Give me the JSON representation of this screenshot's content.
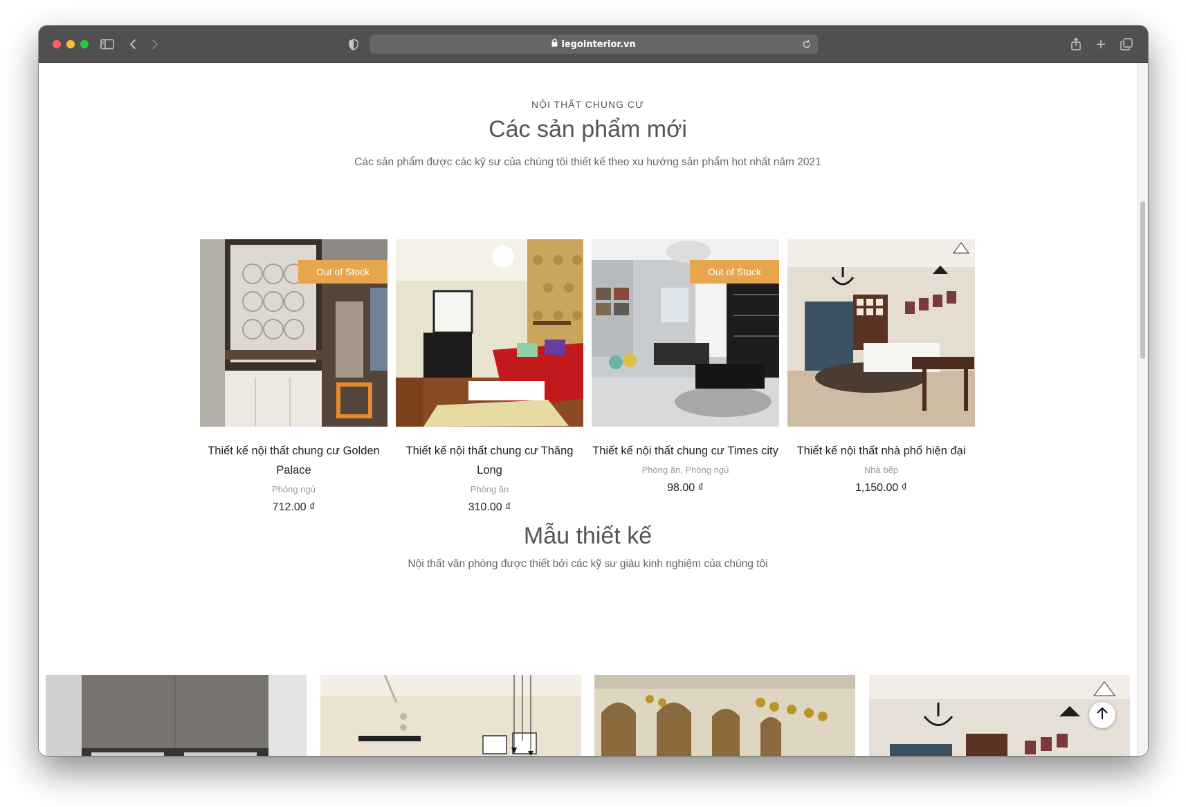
{
  "browser": {
    "url": "legointerior.vn",
    "lock_icon": "lock-icon",
    "icons": [
      "sidebar-icon",
      "back-icon",
      "forward-icon",
      "shield-icon",
      "reload-icon",
      "share-icon",
      "new-tab-icon",
      "tabs-icon"
    ]
  },
  "new_products": {
    "eyebrow": "NỘI THẤT CHUNG CƯ",
    "heading": "Các sản phẩm mới",
    "subheading": "Các sản phẩm được các kỹ sư của chúng tôi thiết kế theo xu hướng sản phẩm hot nhất năm 2021",
    "badge_label": "Out of Stock",
    "badge_color": "#e8a64c",
    "products": [
      {
        "title": "Thiết kế nội thất chung cư Golden Palace",
        "category": "Phòng ngủ",
        "price": "712.00 ₫",
        "out_of_stock": true
      },
      {
        "title": "Thiết kế nội thất chung cư Thăng Long",
        "category": "Phòng ăn",
        "price": "310.00 ₫",
        "out_of_stock": false
      },
      {
        "title": "Thiết kế nội thất chung cư Times city",
        "category": "Phòng ăn, Phòng ngủ",
        "price": "98.00 ₫",
        "out_of_stock": true
      },
      {
        "title": "Thiết kế nội thất nhà phố hiện đại",
        "category": "Nhà bếp",
        "price": "1,150.00 ₫",
        "out_of_stock": false
      }
    ]
  },
  "designs": {
    "heading": "Mẫu thiết kế",
    "subheading": "Nội thất văn phòng được thiết bởi các kỹ sư giàu kinh nghiệm của chúng tôi"
  },
  "back_to_top_icon": "arrow-up-icon"
}
